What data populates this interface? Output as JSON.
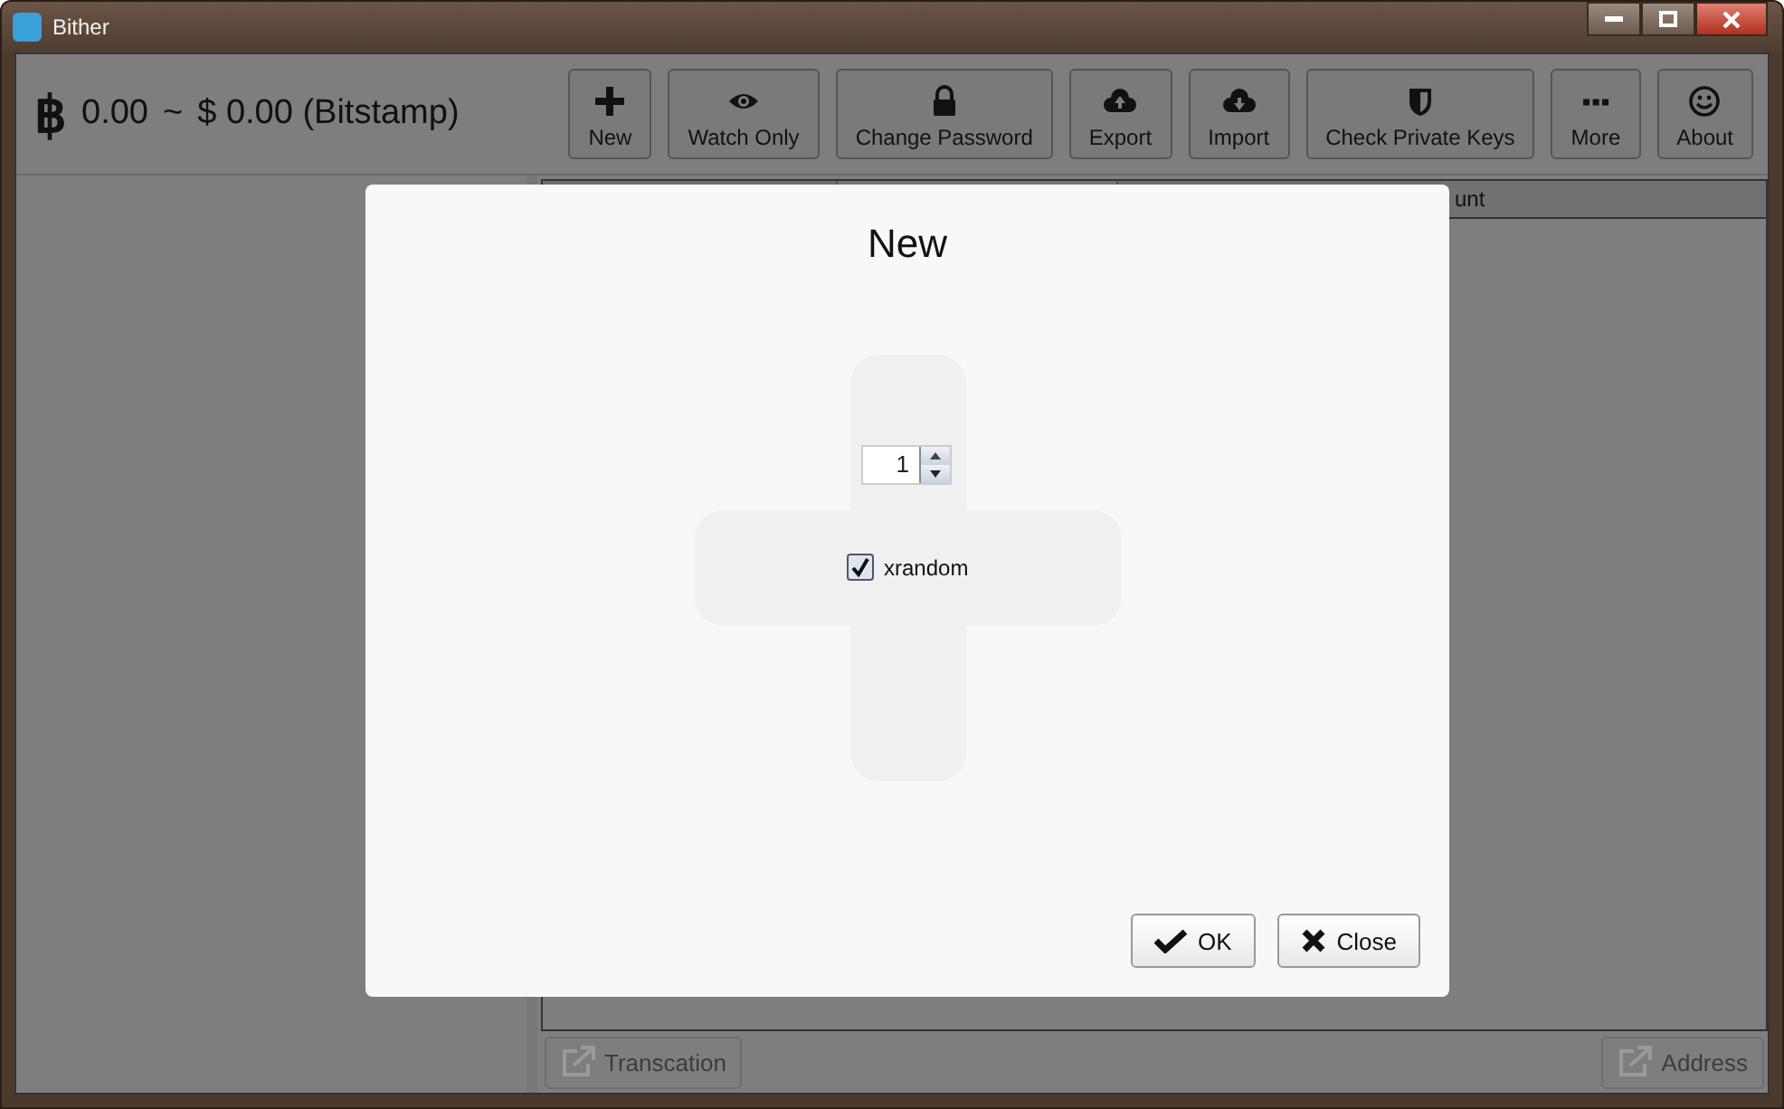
{
  "window": {
    "title": "Bither"
  },
  "balance": {
    "symbol": "฿",
    "btc": "0.00",
    "separator": "~",
    "fiat": "$ 0.00 (Bitstamp)"
  },
  "toolbar": [
    "New",
    "Watch Only",
    "Change Password",
    "Export",
    "Import",
    "Check Private Keys",
    "More",
    "About"
  ],
  "table": {
    "column_3": "unt"
  },
  "footer_buttons": [
    {
      "label": "Transcation",
      "disabled": true
    },
    {
      "label": "Address",
      "disabled": true
    }
  ],
  "dialog": {
    "title": "New",
    "count": "1",
    "option": {
      "label": "xrandom",
      "checked": true
    },
    "buttons": [
      "OK",
      "Close"
    ]
  }
}
